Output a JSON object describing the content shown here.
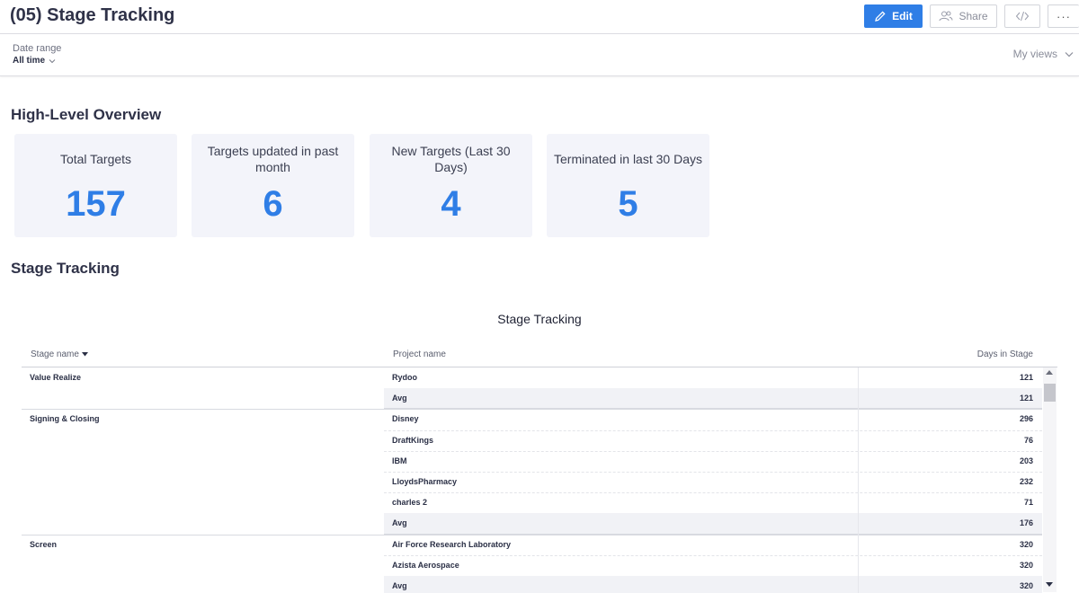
{
  "header": {
    "title": "(05) Stage Tracking",
    "edit_label": "Edit",
    "share_label": "Share",
    "more_label": "···"
  },
  "filters": {
    "date_range_label": "Date range",
    "date_range_value": "All time",
    "my_views_label": "My views"
  },
  "overview": {
    "title": "High-Level Overview",
    "kpis": [
      {
        "label": "Total Targets",
        "value": "157"
      },
      {
        "label": "Targets updated in past month",
        "value": "6"
      },
      {
        "label": "New Targets (Last 30 Days)",
        "value": "4"
      },
      {
        "label": "Terminated in last 30 Days",
        "value": "5"
      }
    ]
  },
  "stage_section": {
    "title": "Stage Tracking",
    "table_title": "Stage Tracking",
    "columns": {
      "stage": "Stage name",
      "project": "Project name",
      "days": "Days in Stage"
    },
    "rows": [
      {
        "stage": "Value Realize",
        "project": "Rydoo",
        "days": "121",
        "avg": false
      },
      {
        "stage": "",
        "project": "Avg",
        "days": "121",
        "avg": true
      },
      {
        "stage": "Signing & Closing",
        "project": "Disney",
        "days": "296",
        "avg": false
      },
      {
        "stage": "",
        "project": "DraftKings",
        "days": "76",
        "avg": false
      },
      {
        "stage": "",
        "project": "IBM",
        "days": "203",
        "avg": false
      },
      {
        "stage": "",
        "project": "LloydsPharmacy",
        "days": "232",
        "avg": false
      },
      {
        "stage": "",
        "project": "charles 2",
        "days": "71",
        "avg": false
      },
      {
        "stage": "",
        "project": "Avg",
        "days": "176",
        "avg": true
      },
      {
        "stage": "Screen",
        "project": "Air Force Research Laboratory",
        "days": "320",
        "avg": false
      },
      {
        "stage": "",
        "project": "Azista Aerospace",
        "days": "320",
        "avg": false
      },
      {
        "stage": "",
        "project": "Avg",
        "days": "320",
        "avg": true
      }
    ]
  },
  "colors": {
    "accent": "#2f7ee6",
    "kpi_background": "#f3f4fa",
    "title_text": "#2f3248"
  }
}
